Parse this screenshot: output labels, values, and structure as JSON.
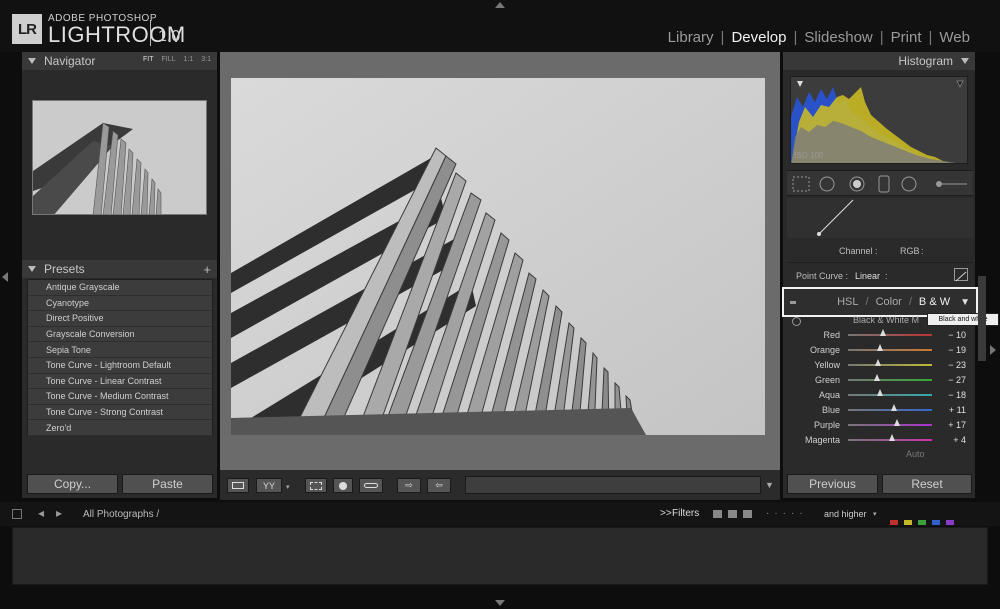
{
  "app": {
    "logo_text": "LR",
    "brand_top": "ADOBE PHOTOSHOP",
    "brand_name": "LIGHTROOM",
    "version": "1.0"
  },
  "modules": [
    {
      "label": "Library",
      "active": false
    },
    {
      "label": "Develop",
      "active": true
    },
    {
      "label": "Slideshow",
      "active": false
    },
    {
      "label": "Print",
      "active": false
    },
    {
      "label": "Web",
      "active": false
    }
  ],
  "navigator": {
    "title": "Navigator",
    "zoom": [
      "FIT",
      "FILL",
      "1:1",
      "3:1"
    ]
  },
  "presets": {
    "title": "Presets",
    "items": [
      "Antique Grayscale",
      "Cyanotype",
      "Direct Positive",
      "Grayscale Conversion",
      "Sepia Tone",
      "Tone Curve - Lightroom Default",
      "Tone Curve - Linear Contrast",
      "Tone Curve - Medium Contrast",
      "Tone Curve - Strong Contrast",
      "Zero'd"
    ]
  },
  "left_buttons": {
    "copy": "Copy...",
    "paste": "Paste"
  },
  "toolbar": {
    "compare": "YY"
  },
  "histogram": {
    "title": "Histogram",
    "iso": "ISO 100"
  },
  "tone_curve": {
    "channel_label": "Channel :",
    "channel_value": "RGB",
    "point_curve_label": "Point Curve :",
    "point_curve_value": "Linear"
  },
  "hsl": {
    "tabs": [
      "HSL",
      "Color",
      "B & W"
    ],
    "active_tab": "B & W",
    "tooltip": "Black and white",
    "section_label": "Black & White M",
    "sliders": [
      {
        "label": "Red",
        "value": "− 10",
        "pos": 0.42,
        "color": "#b33"
      },
      {
        "label": "Orange",
        "value": "− 19",
        "pos": 0.38,
        "color": "#c73"
      },
      {
        "label": "Yellow",
        "value": "− 23",
        "pos": 0.36,
        "color": "#bb3"
      },
      {
        "label": "Green",
        "value": "− 27",
        "pos": 0.34,
        "color": "#3a3"
      },
      {
        "label": "Aqua",
        "value": "− 18",
        "pos": 0.38,
        "color": "#3aa"
      },
      {
        "label": "Blue",
        "value": "+ 11",
        "pos": 0.55,
        "color": "#36c"
      },
      {
        "label": "Purple",
        "value": "+ 17",
        "pos": 0.58,
        "color": "#a3c"
      },
      {
        "label": "Magenta",
        "value": "+ 4",
        "pos": 0.52,
        "color": "#c3a"
      }
    ],
    "auto_label": "Auto"
  },
  "right_buttons": {
    "previous": "Previous",
    "reset": "Reset"
  },
  "filmstrip": {
    "path": "All Photographs /",
    "filters_label": "Filters",
    "rating_filter": "and higher",
    "color_labels": [
      "#c0302a",
      "#c8b62a",
      "#3aa03a",
      "#3060c8",
      "#8a3ac8"
    ]
  }
}
